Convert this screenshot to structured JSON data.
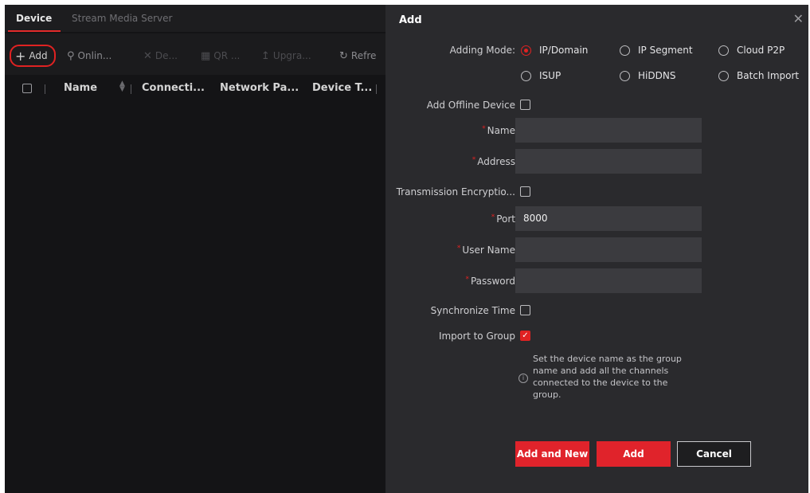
{
  "tabs": [
    {
      "label": "Device"
    },
    {
      "label": "Stream Media Server"
    }
  ],
  "toolbar": {
    "add": "Add",
    "online": "Onlin...",
    "delete": "De...",
    "qr": "QR ...",
    "upgrade": "Upgra...",
    "refresh": "Refre"
  },
  "table": {
    "columns": [
      "Name",
      "Connecti...",
      "Network Pa...",
      "Device T..."
    ]
  },
  "dialog": {
    "title": "Add",
    "adding_mode_label": "Adding Mode:",
    "modes": [
      {
        "label": "IP/Domain",
        "checked": true
      },
      {
        "label": "IP Segment",
        "checked": false
      },
      {
        "label": "Cloud P2P",
        "checked": false
      },
      {
        "label": "ISUP",
        "checked": false
      },
      {
        "label": "HiDDNS",
        "checked": false
      },
      {
        "label": "Batch Import",
        "checked": false
      }
    ],
    "offline_label": "Add Offline Device",
    "name_label": "Name",
    "name_value": "",
    "address_label": "Address",
    "address_value": "",
    "encryption_label": "Transmission Encryptio...",
    "port_label": "Port",
    "port_value": "8000",
    "username_label": "User Name",
    "username_value": "",
    "password_label": "Password",
    "password_value": "",
    "sync_label": "Synchronize Time",
    "import_label": "Import to Group",
    "import_checked": true,
    "import_hint": "Set the device name as the group name and add all the channels connected to the device to the group.",
    "add_and_new": "Add and New",
    "add": "Add",
    "cancel": "Cancel"
  },
  "colors": {
    "accent": "#e0232b",
    "panel": "#2a2a2d",
    "background": "#141416"
  }
}
